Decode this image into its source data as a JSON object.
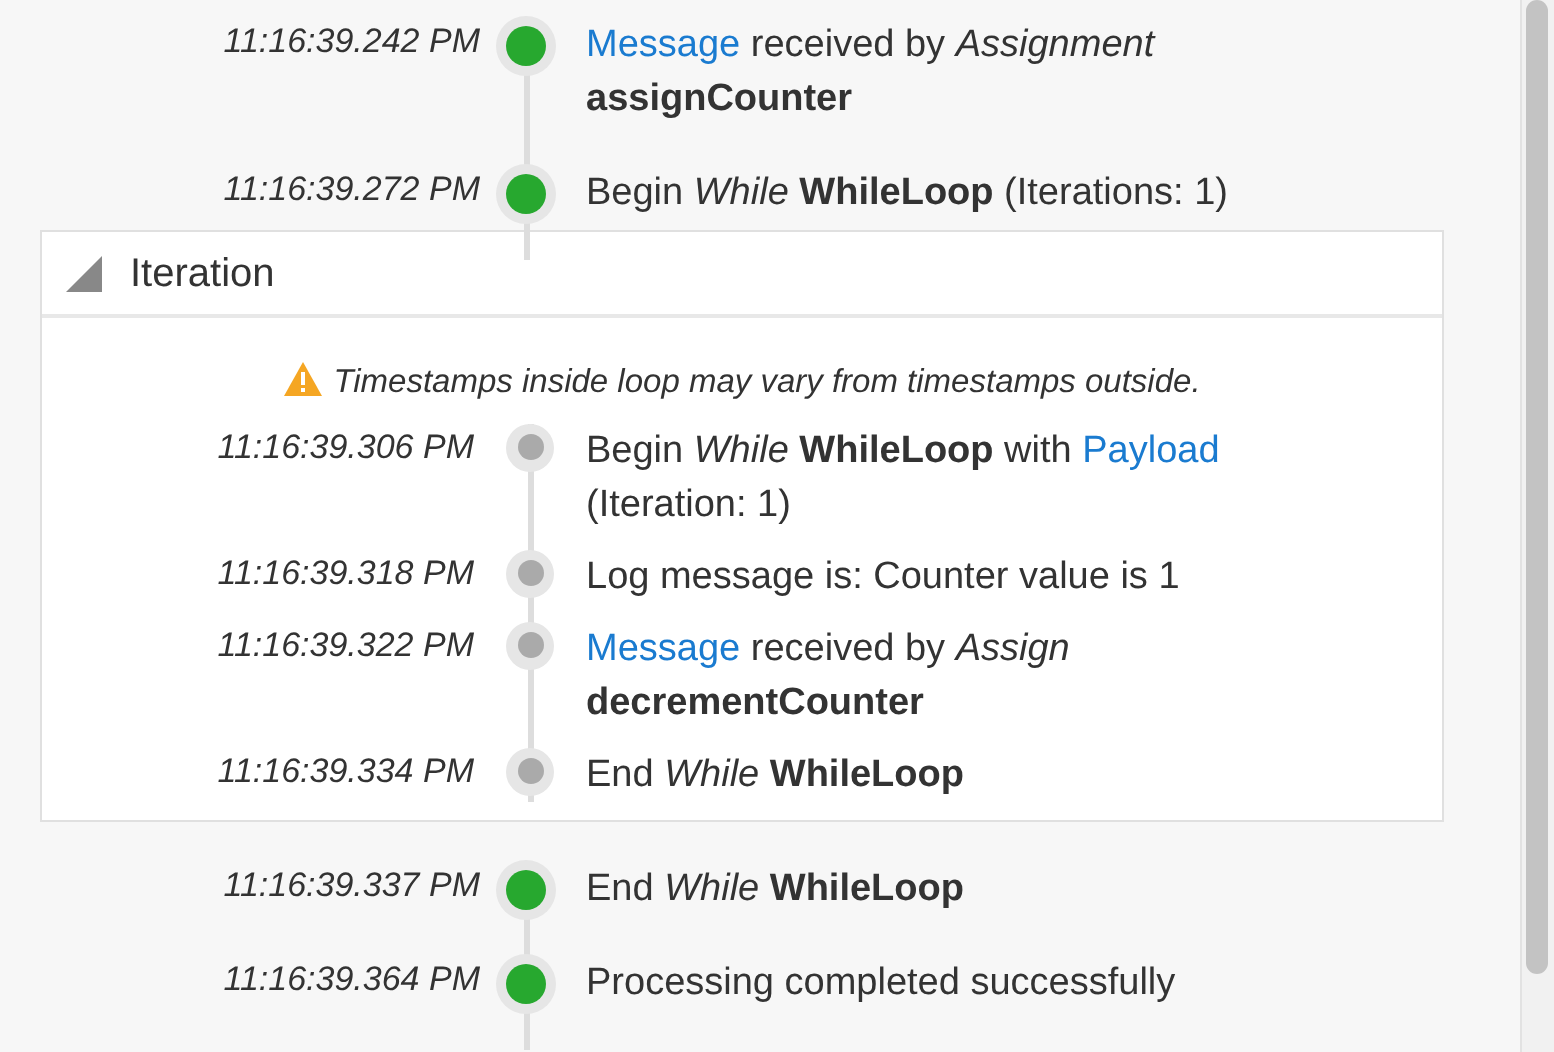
{
  "timeline": [
    {
      "kind": "event",
      "time": "11:16:39.242 PM",
      "color": "#27a82f",
      "message": [
        {
          "kind": "link",
          "text": "Message"
        },
        {
          "kind": "text",
          "text": " received by "
        },
        {
          "kind": "italic",
          "text": "Assignment "
        },
        {
          "kind": "bold",
          "text": "assignCounter"
        }
      ]
    },
    {
      "kind": "event",
      "time": "11:16:39.272 PM",
      "color": "#27a82f",
      "message": [
        {
          "kind": "text",
          "text": "Begin "
        },
        {
          "kind": "italic",
          "text": "While "
        },
        {
          "kind": "bold",
          "text": "WhileLoop"
        },
        {
          "kind": "text",
          "text": " (Iterations: 1)"
        }
      ]
    },
    {
      "kind": "group",
      "title": "Iteration",
      "expanded": true,
      "note": "Timestamps inside loop may vary from timestamps outside.",
      "events": [
        {
          "time": "11:16:39.306 PM",
          "color": "#aaaaaa",
          "message": [
            {
              "kind": "text",
              "text": "Begin "
            },
            {
              "kind": "italic",
              "text": "While "
            },
            {
              "kind": "bold",
              "text": "WhileLoop"
            },
            {
              "kind": "text",
              "text": " with "
            },
            {
              "kind": "link",
              "text": "Payload"
            },
            {
              "kind": "text",
              "text": " (Iteration: 1)"
            }
          ]
        },
        {
          "time": "11:16:39.318 PM",
          "color": "#aaaaaa",
          "message": [
            {
              "kind": "text",
              "text": "Log message is: Counter value is 1"
            }
          ]
        },
        {
          "time": "11:16:39.322 PM",
          "color": "#aaaaaa",
          "message": [
            {
              "kind": "link",
              "text": "Message"
            },
            {
              "kind": "text",
              "text": " received by "
            },
            {
              "kind": "italic",
              "text": "Assign "
            },
            {
              "kind": "bold",
              "text": "decrementCounter"
            }
          ]
        },
        {
          "time": "11:16:39.334 PM",
          "color": "#aaaaaa",
          "message": [
            {
              "kind": "text",
              "text": "End "
            },
            {
              "kind": "italic",
              "text": "While "
            },
            {
              "kind": "bold",
              "text": "WhileLoop"
            }
          ]
        }
      ]
    },
    {
      "kind": "event",
      "time": "11:16:39.337 PM",
      "color": "#27a82f",
      "message": [
        {
          "kind": "text",
          "text": "End "
        },
        {
          "kind": "italic",
          "text": "While "
        },
        {
          "kind": "bold",
          "text": "WhileLoop"
        }
      ]
    },
    {
      "kind": "event",
      "time": "11:16:39.364 PM",
      "color": "#27a82f",
      "message": [
        {
          "kind": "text",
          "text": "Processing completed successfully"
        }
      ]
    }
  ]
}
